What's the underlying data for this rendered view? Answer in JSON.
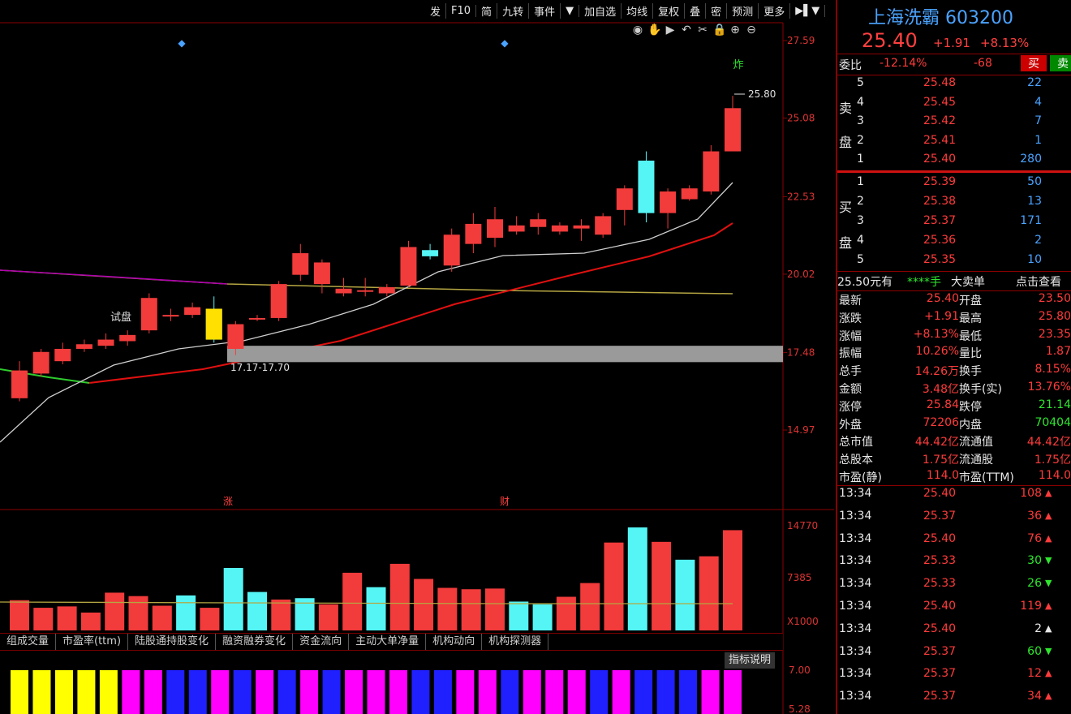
{
  "toolbar": [
    "发",
    "F10",
    "简",
    "九转",
    "事件",
    "▼",
    "加自选",
    "均线",
    "复权",
    "叠",
    "密",
    "预测",
    "更多",
    "▶▌▼"
  ],
  "chart_data": [
    {
      "type": "candlestick",
      "price_axis": {
        "ticks": [
          "27.59",
          "25.08",
          "22.53",
          "20.02",
          "17.48",
          "14.97"
        ]
      },
      "marks": {
        "top_left_diamond": "◆",
        "top_mid_diamond": "◆",
        "zha_label": "炸",
        "max_label": "25.80"
      },
      "annotations": [
        {
          "text": "试盘"
        },
        {
          "text": "17.17-17.70"
        },
        {
          "text": "涨"
        },
        {
          "text": "财"
        }
      ],
      "candles": [
        {
          "o": 16.0,
          "c": 16.9,
          "h": 17.2,
          "l": 15.9
        },
        {
          "o": 16.8,
          "c": 17.5,
          "h": 17.6,
          "l": 16.7
        },
        {
          "o": 17.2,
          "c": 17.6,
          "h": 17.8,
          "l": 17.1
        },
        {
          "o": 17.6,
          "c": 17.75,
          "h": 17.9,
          "l": 17.5
        },
        {
          "o": 17.7,
          "c": 17.9,
          "h": 18.1,
          "l": 17.6
        },
        {
          "o": 17.85,
          "c": 18.05,
          "h": 18.2,
          "l": 17.7
        },
        {
          "o": 18.2,
          "c": 19.25,
          "h": 19.4,
          "l": 18.1
        },
        {
          "o": 18.7,
          "c": 18.7,
          "h": 18.9,
          "l": 18.5
        },
        {
          "o": 18.7,
          "c": 18.95,
          "h": 19.1,
          "l": 18.6
        },
        {
          "o": 18.9,
          "c": 17.9,
          "h": 19.3,
          "l": 17.8
        },
        {
          "o": 17.6,
          "c": 18.4,
          "h": 18.5,
          "l": 17.4
        },
        {
          "o": 18.6,
          "c": 18.6,
          "h": 18.7,
          "l": 18.5
        },
        {
          "o": 18.6,
          "c": 19.7,
          "h": 19.8,
          "l": 18.5
        },
        {
          "o": 20.0,
          "c": 20.7,
          "h": 21.0,
          "l": 19.8
        },
        {
          "o": 19.7,
          "c": 20.4,
          "h": 20.5,
          "l": 19.4
        },
        {
          "o": 19.4,
          "c": 19.55,
          "h": 19.9,
          "l": 19.3
        },
        {
          "o": 19.45,
          "c": 19.5,
          "h": 19.9,
          "l": 19.3
        },
        {
          "o": 19.4,
          "c": 19.6,
          "h": 19.7,
          "l": 19.3
        },
        {
          "o": 19.65,
          "c": 20.9,
          "h": 21.1,
          "l": 19.6
        },
        {
          "o": 20.8,
          "c": 20.6,
          "h": 21.0,
          "l": 20.5
        },
        {
          "o": 20.3,
          "c": 21.3,
          "h": 21.5,
          "l": 20.1
        },
        {
          "o": 21.0,
          "c": 21.65,
          "h": 22.0,
          "l": 20.7
        },
        {
          "o": 21.2,
          "c": 21.8,
          "h": 22.2,
          "l": 20.9
        },
        {
          "o": 21.4,
          "c": 21.6,
          "h": 21.9,
          "l": 21.3
        },
        {
          "o": 21.55,
          "c": 21.8,
          "h": 22.0,
          "l": 21.3
        },
        {
          "o": 21.4,
          "c": 21.6,
          "h": 21.7,
          "l": 21.3
        },
        {
          "o": 21.5,
          "c": 21.6,
          "h": 21.8,
          "l": 21.1
        },
        {
          "o": 21.3,
          "c": 21.9,
          "h": 22.0,
          "l": 21.2
        },
        {
          "o": 22.1,
          "c": 22.8,
          "h": 22.9,
          "l": 21.6
        },
        {
          "o": 23.7,
          "c": 22.0,
          "h": 24.0,
          "l": 21.7
        },
        {
          "o": 22.0,
          "c": 22.7,
          "h": 22.8,
          "l": 21.5
        },
        {
          "o": 22.45,
          "c": 22.8,
          "h": 22.9,
          "l": 22.4
        },
        {
          "o": 22.7,
          "c": 24.0,
          "h": 24.2,
          "l": 22.6
        },
        {
          "o": 24.0,
          "c": 25.4,
          "h": 25.8,
          "l": 24.0
        }
      ],
      "support_band": {
        "low": 17.17,
        "high": 17.7
      },
      "volume": {
        "ticks": [
          "14770",
          "7385",
          "X1000"
        ],
        "bars": [
          {
            "v": 4400,
            "up": true
          },
          {
            "v": 3300,
            "up": true
          },
          {
            "v": 3500,
            "up": true
          },
          {
            "v": 2600,
            "up": true
          },
          {
            "v": 5500,
            "up": true
          },
          {
            "v": 5000,
            "up": true
          },
          {
            "v": 3600,
            "up": true
          },
          {
            "v": 5100,
            "up": false
          },
          {
            "v": 3300,
            "up": true
          },
          {
            "v": 9100,
            "up": false
          },
          {
            "v": 5600,
            "up": false
          },
          {
            "v": 4500,
            "up": true
          },
          {
            "v": 4700,
            "up": false
          },
          {
            "v": 3800,
            "up": true
          },
          {
            "v": 8400,
            "up": true
          },
          {
            "v": 6300,
            "up": false
          },
          {
            "v": 9700,
            "up": true
          },
          {
            "v": 7500,
            "up": true
          },
          {
            "v": 6200,
            "up": true
          },
          {
            "v": 6000,
            "up": true
          },
          {
            "v": 6100,
            "up": true
          },
          {
            "v": 4200,
            "up": false
          },
          {
            "v": 3800,
            "up": false
          },
          {
            "v": 4900,
            "up": true
          },
          {
            "v": 6900,
            "up": true
          },
          {
            "v": 12800,
            "up": true
          },
          {
            "v": 15000,
            "up": false
          },
          {
            "v": 12900,
            "up": true
          },
          {
            "v": 10300,
            "up": false
          },
          {
            "v": 10800,
            "up": true
          },
          {
            "v": 14600,
            "up": true
          }
        ]
      },
      "indicator": {
        "ticks": [
          "7.00",
          "5.28"
        ],
        "colors": [
          "#ffff00",
          "#ffff00",
          "#ffff00",
          "#ffff00",
          "#ffff00",
          "#ff00ff",
          "#ff00ff",
          "#2020ff",
          "#2020ff",
          "#ff00ff",
          "#2020ff",
          "#ff00ff",
          "#2020ff",
          "#ff00ff",
          "#2020ff",
          "#ff00ff",
          "#ff00ff",
          "#ff00ff",
          "#2020ff",
          "#2020ff",
          "#ff00ff",
          "#ff00ff",
          "#2020ff",
          "#ff00ff",
          "#ff00ff",
          "#ff00ff",
          "#2020ff",
          "#ff00ff",
          "#2020ff",
          "#2020ff",
          "#2020ff",
          "#ff00ff",
          "#ff00ff"
        ]
      }
    }
  ],
  "indicator_tabs": [
    "组成交量",
    "市盈率(ttm)",
    "陆股通持股变化",
    "融资融券变化",
    "资金流向",
    "主动大单净量",
    "机构动向",
    "机构探测器"
  ],
  "indicator_explain": "指标说明",
  "panel": {
    "name": "上海洗霸",
    "code": "603200",
    "price": "25.40",
    "change": "+1.91",
    "change_pct": "+8.13%",
    "weibi_label": "委比",
    "weibi": "-12.14%",
    "weicha": "-68",
    "buy_btn": "买",
    "sell_btn": "卖",
    "sell_label": [
      "卖",
      "盘"
    ],
    "buy_label": [
      "买",
      "盘"
    ],
    "asks": [
      {
        "lvl": "5",
        "p": "25.48",
        "v": "22"
      },
      {
        "lvl": "4",
        "p": "25.45",
        "v": "4"
      },
      {
        "lvl": "3",
        "p": "25.42",
        "v": "7"
      },
      {
        "lvl": "2",
        "p": "25.41",
        "v": "1"
      },
      {
        "lvl": "1",
        "p": "25.40",
        "v": "280"
      }
    ],
    "bids": [
      {
        "lvl": "1",
        "p": "25.39",
        "v": "50"
      },
      {
        "lvl": "2",
        "p": "25.38",
        "v": "13"
      },
      {
        "lvl": "3",
        "p": "25.37",
        "v": "171"
      },
      {
        "lvl": "4",
        "p": "25.36",
        "v": "2"
      },
      {
        "lvl": "5",
        "p": "25.35",
        "v": "10"
      }
    ],
    "big_order": {
      "a": "25.50元有",
      "b": "****手",
      "c": "大卖单",
      "d": "点击查看"
    },
    "stats": [
      [
        "最新",
        "25.40",
        "开盘",
        "23.50"
      ],
      [
        "涨跌",
        "+1.91",
        "最高",
        "25.80"
      ],
      [
        "涨幅",
        "+8.13%",
        "最低",
        "23.35"
      ],
      [
        "振幅",
        "10.26%",
        "量比",
        "1.87"
      ],
      [
        "总手",
        "14.26万",
        "换手",
        "8.15%"
      ],
      [
        "金额",
        "3.48亿",
        "换手(实)",
        "13.76%"
      ],
      [
        "涨停",
        "25.84",
        "跌停",
        "21.14"
      ],
      [
        "外盘",
        "72206",
        "内盘",
        "70404"
      ],
      [
        "总市值",
        "44.42亿",
        "流通值",
        "44.42亿"
      ],
      [
        "总股本",
        "1.75亿",
        "流通股",
        "1.75亿"
      ],
      [
        "市盈(静)",
        "114.0",
        "市盈(TTM)",
        "114.0"
      ]
    ],
    "ticks": [
      {
        "t": "13:34",
        "p": "25.40",
        "v": "108",
        "d": "up"
      },
      {
        "t": "13:34",
        "p": "25.37",
        "v": "36",
        "d": "up"
      },
      {
        "t": "13:34",
        "p": "25.40",
        "v": "76",
        "d": "up"
      },
      {
        "t": "13:34",
        "p": "25.33",
        "v": "30",
        "d": "down"
      },
      {
        "t": "13:34",
        "p": "25.33",
        "v": "26",
        "d": "down"
      },
      {
        "t": "13:34",
        "p": "25.40",
        "v": "119",
        "d": "up"
      },
      {
        "t": "13:34",
        "p": "25.40",
        "v": "2",
        "d": "flat"
      },
      {
        "t": "13:34",
        "p": "25.37",
        "v": "60",
        "d": "down"
      },
      {
        "t": "13:34",
        "p": "25.37",
        "v": "12",
        "d": "up"
      },
      {
        "t": "13:34",
        "p": "25.37",
        "v": "34",
        "d": "up"
      }
    ]
  }
}
